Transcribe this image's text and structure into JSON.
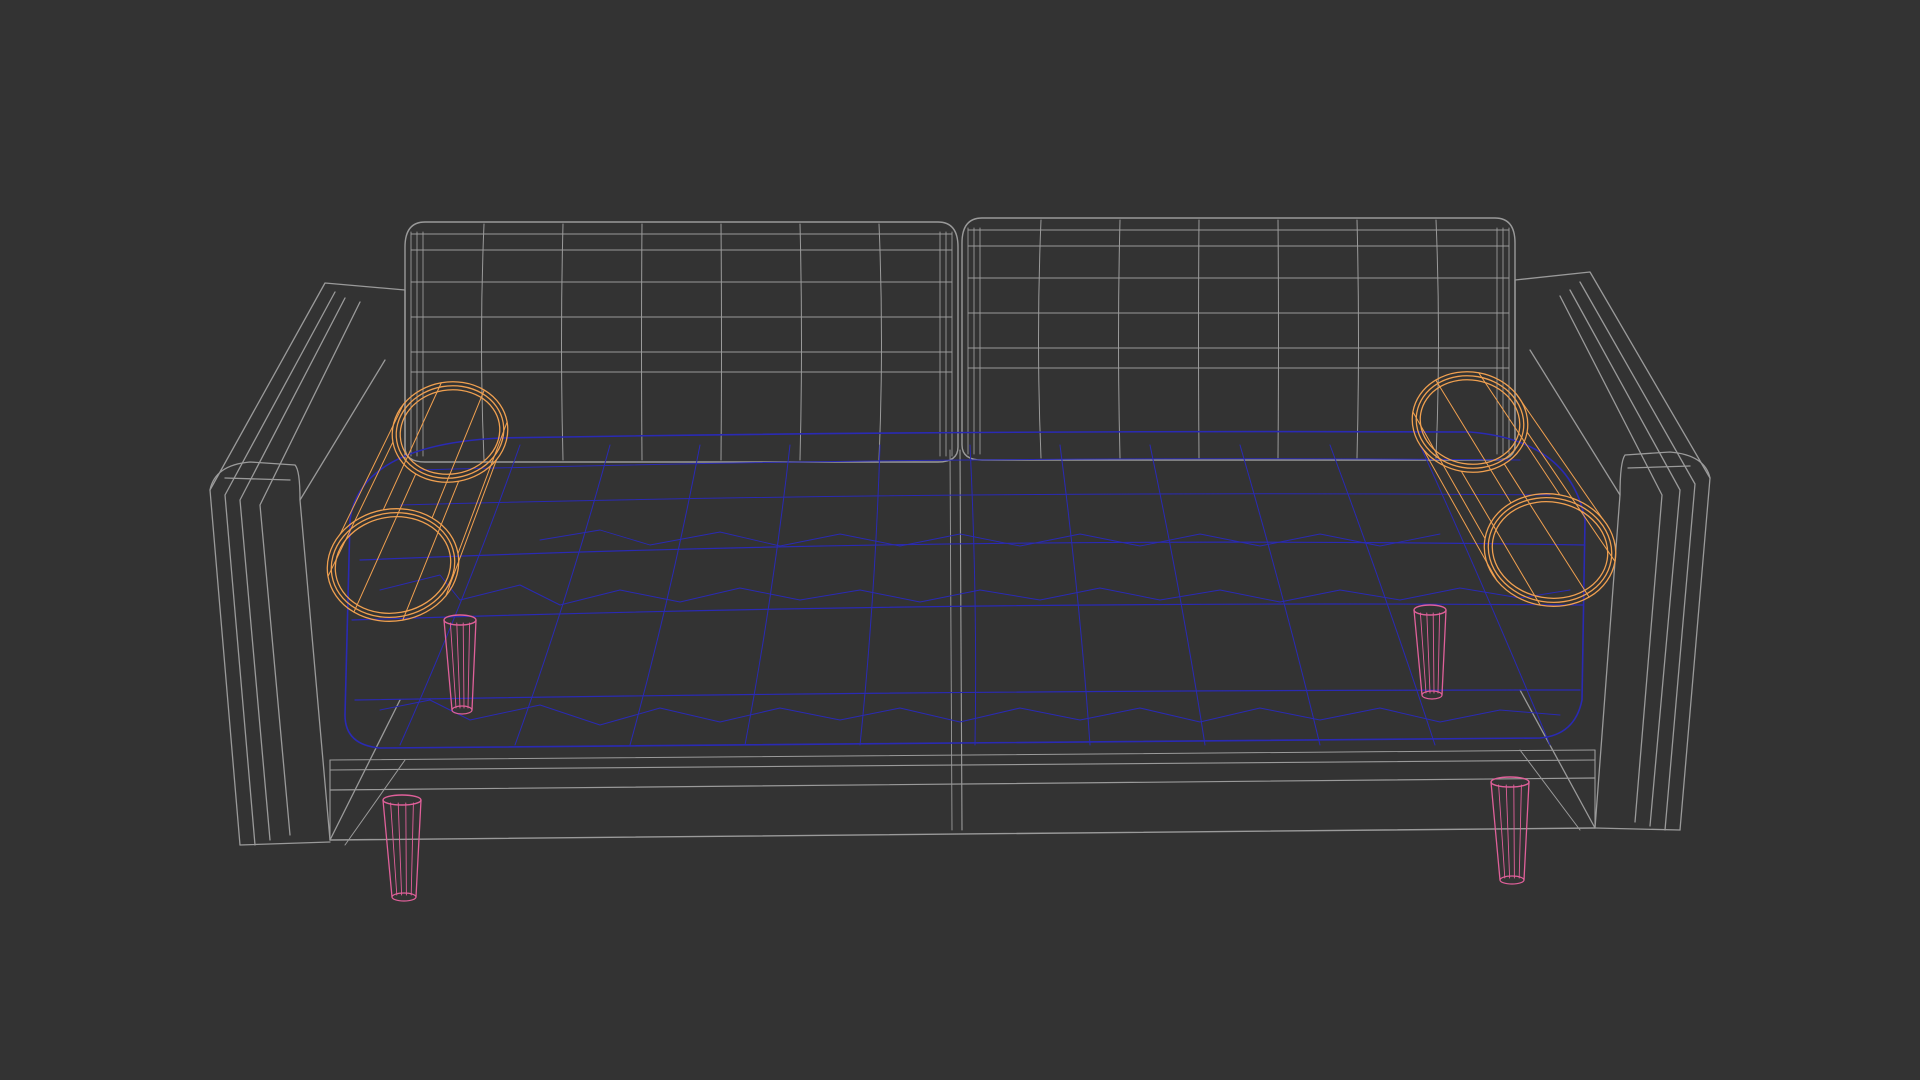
{
  "viewport": {
    "background": "#333333",
    "render_mode": "wireframe"
  },
  "scene": {
    "subject": "sofa",
    "parts": [
      {
        "name": "backrest-cushion-left",
        "color": "#9a9a9a"
      },
      {
        "name": "backrest-cushion-right",
        "color": "#9a9a9a"
      },
      {
        "name": "armrest-left",
        "color": "#9a9a9a"
      },
      {
        "name": "armrest-right",
        "color": "#9a9a9a"
      },
      {
        "name": "base-frame",
        "color": "#9a9a9a"
      },
      {
        "name": "seat-cushion",
        "color": "#2a2ab4"
      },
      {
        "name": "bolster-pillow-left",
        "color": "#f0a050"
      },
      {
        "name": "bolster-pillow-right",
        "color": "#f0a050"
      },
      {
        "name": "leg-front-left",
        "color": "#e0609a"
      },
      {
        "name": "leg-front-right",
        "color": "#e0609a"
      },
      {
        "name": "leg-back-left",
        "color": "#e0609a"
      },
      {
        "name": "leg-back-right",
        "color": "#e0609a"
      }
    ]
  }
}
